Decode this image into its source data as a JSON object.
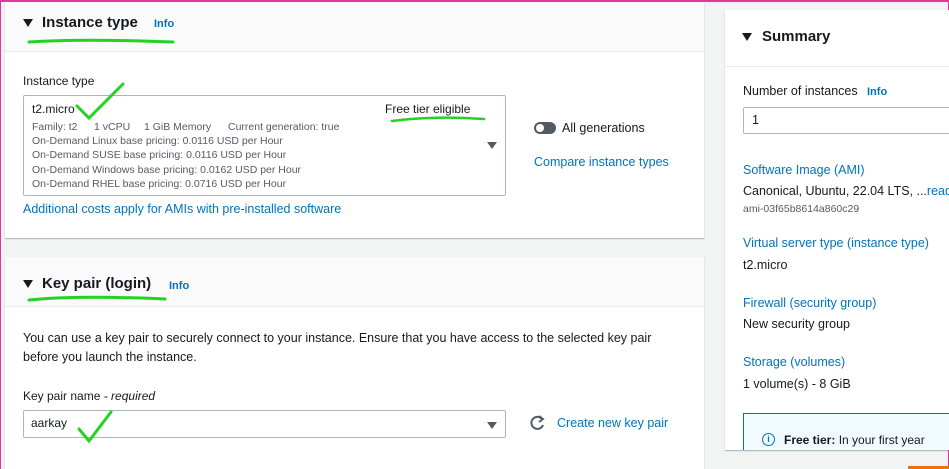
{
  "instance_type": {
    "title": "Instance type",
    "info": "Info",
    "field_label": "Instance type",
    "selected": {
      "name": "t2.micro",
      "badge": "Free tier eligible",
      "family": "Family: t2",
      "vcpu": "1 vCPU",
      "memory": "1 GiB Memory",
      "generation": "Current generation: true",
      "pricing": [
        "On-Demand Linux base pricing: 0.0116 USD per Hour",
        "On-Demand SUSE base pricing: 0.0116 USD per Hour",
        "On-Demand Windows base pricing: 0.0162 USD per Hour",
        "On-Demand RHEL base pricing: 0.0716 USD per Hour"
      ]
    },
    "all_generations_label": "All generations",
    "compare_link": "Compare instance types",
    "additional_costs_link": "Additional costs apply for AMIs with pre-installed software"
  },
  "key_pair": {
    "title": "Key pair (login)",
    "info": "Info",
    "description_line1": "You can use a key pair to securely connect to your instance. Ensure that you have access to the selected key pair",
    "description_line2": "before you launch the instance.",
    "field_label": "Key pair name",
    "required_suffix": "- required",
    "selected": "aarkay",
    "create_link": "Create new key pair"
  },
  "summary": {
    "title": "Summary",
    "instances_label": "Number of instances",
    "info": "Info",
    "instances_value": "1",
    "ami_label": "Software Image (AMI)",
    "ami_value": "Canonical, Ubuntu, 22.04 LTS, ...",
    "ami_read_more": "read",
    "ami_id": "ami-03f65b8614a860c29",
    "vst_label": "Virtual server type (instance type)",
    "vst_value": "t2.micro",
    "firewall_label": "Firewall (security group)",
    "firewall_value": "New security group",
    "storage_label": "Storage (volumes)",
    "storage_value": "1 volume(s) - 8 GiB",
    "free_tier_bold": "Free tier:",
    "free_tier_text": " In your first year"
  },
  "colors": {
    "link": "#0073bb",
    "annotation": "#22d322",
    "border": "#e0379b"
  }
}
